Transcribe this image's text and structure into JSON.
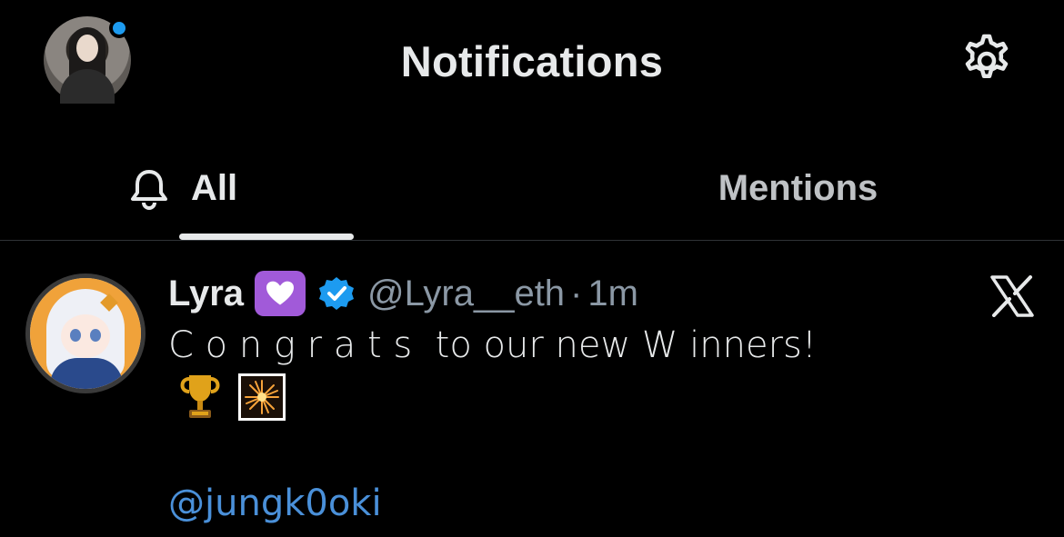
{
  "header": {
    "title": "Notifications",
    "avatar_icon": "profile-avatar",
    "settings_icon": "gear-icon",
    "presence_color": "#1d9bf0"
  },
  "tabs": [
    {
      "label": "All",
      "icon": "bell-icon",
      "selected": true
    },
    {
      "label": "Mentions",
      "selected": false
    }
  ],
  "notification": {
    "display_name": "Lyra",
    "name_emoji": "💟",
    "verified": true,
    "handle": "@Lyra__eth",
    "separator": "·",
    "time": "1m",
    "source_icon": "x-logo-icon",
    "text": "C o n g r a t s  to our new W inners!",
    "emojis": [
      "🏆",
      "🎇"
    ],
    "mention": "@jungk0oki"
  },
  "colors": {
    "background": "#000000",
    "text": "#e7e9ea",
    "muted": "#8b98a5",
    "link": "#4a90d9",
    "verified": "#1d9bf0"
  }
}
